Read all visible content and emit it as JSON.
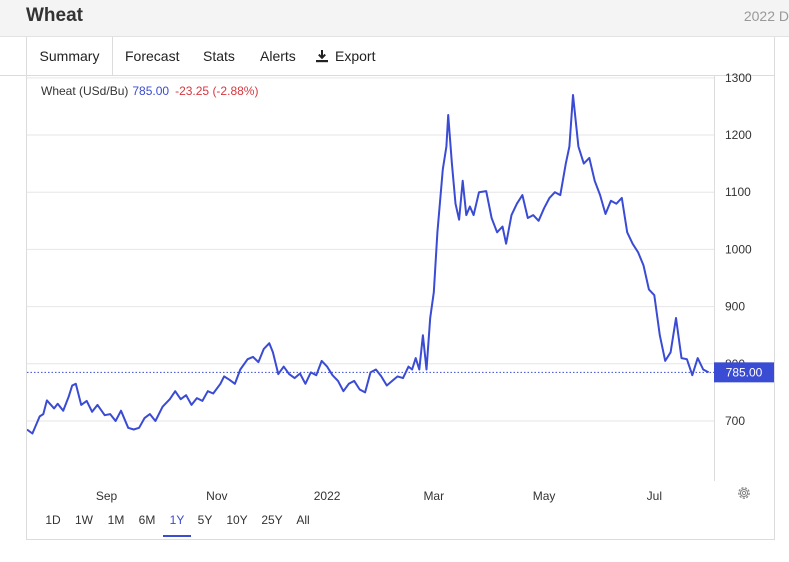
{
  "header": {
    "title": "Wheat",
    "year_label": "2022 D"
  },
  "tabs": [
    {
      "label": "Summary",
      "active": true
    },
    {
      "label": "Forecast"
    },
    {
      "label": "Stats"
    },
    {
      "label": "Alerts"
    },
    {
      "label": "Export",
      "icon": "download-icon"
    }
  ],
  "legend": {
    "instrument": "Wheat (USd/Bu)",
    "price": "785.00",
    "change": "-23.25 (-2.88%)"
  },
  "ranges": [
    {
      "label": "1D"
    },
    {
      "label": "1W"
    },
    {
      "label": "1M"
    },
    {
      "label": "6M"
    },
    {
      "label": "1Y",
      "active": true
    },
    {
      "label": "5Y"
    },
    {
      "label": "10Y"
    },
    {
      "label": "25Y"
    },
    {
      "label": "All"
    }
  ],
  "colors": {
    "line": "#3a4bd4",
    "price_tag": "#3a4bd4",
    "negative": "#d9363e",
    "grid": "#e6e6e6"
  },
  "chart_data": {
    "type": "line",
    "title": "Wheat (USd/Bu)",
    "xlabel": "",
    "ylabel": "",
    "ylim": [
      595,
      1305
    ],
    "y_ticks": [
      700,
      800,
      900,
      1000,
      1100,
      1200,
      1300
    ],
    "y_tick_labels": [
      "700",
      "800",
      "900",
      "1000",
      "1100",
      "1200",
      "1300"
    ],
    "x_ticks": [
      {
        "label": "Sep",
        "date": "2021-09-01"
      },
      {
        "label": "Nov",
        "date": "2021-11-01"
      },
      {
        "label": "2022",
        "date": "2022-01-01"
      },
      {
        "label": "Mar",
        "date": "2022-03-01"
      },
      {
        "label": "May",
        "date": "2022-05-01"
      },
      {
        "label": "Jul",
        "date": "2022-07-01"
      }
    ],
    "last_value": 785.0,
    "last_label": "785.00",
    "grid": true,
    "series": [
      {
        "name": "Wheat (USd/Bu)",
        "points": [
          [
            "2021-07-19",
            685
          ],
          [
            "2021-07-22",
            678
          ],
          [
            "2021-07-26",
            708
          ],
          [
            "2021-07-28",
            712
          ],
          [
            "2021-07-30",
            736
          ],
          [
            "2021-08-03",
            722
          ],
          [
            "2021-08-05",
            730
          ],
          [
            "2021-08-08",
            718
          ],
          [
            "2021-08-11",
            742
          ],
          [
            "2021-08-13",
            762
          ],
          [
            "2021-08-15",
            765
          ],
          [
            "2021-08-18",
            728
          ],
          [
            "2021-08-21",
            735
          ],
          [
            "2021-08-24",
            716
          ],
          [
            "2021-08-27",
            728
          ],
          [
            "2021-08-31",
            710
          ],
          [
            "2021-09-03",
            712
          ],
          [
            "2021-09-06",
            700
          ],
          [
            "2021-09-09",
            718
          ],
          [
            "2021-09-13",
            688
          ],
          [
            "2021-09-16",
            685
          ],
          [
            "2021-09-19",
            688
          ],
          [
            "2021-09-22",
            705
          ],
          [
            "2021-09-25",
            712
          ],
          [
            "2021-09-28",
            700
          ],
          [
            "2021-10-02",
            725
          ],
          [
            "2021-10-06",
            738
          ],
          [
            "2021-10-09",
            752
          ],
          [
            "2021-10-12",
            738
          ],
          [
            "2021-10-15",
            745
          ],
          [
            "2021-10-18",
            728
          ],
          [
            "2021-10-21",
            740
          ],
          [
            "2021-10-24",
            735
          ],
          [
            "2021-10-27",
            752
          ],
          [
            "2021-10-30",
            748
          ],
          [
            "2021-11-03",
            765
          ],
          [
            "2021-11-05",
            778
          ],
          [
            "2021-11-08",
            772
          ],
          [
            "2021-11-11",
            765
          ],
          [
            "2021-11-14",
            790
          ],
          [
            "2021-11-18",
            808
          ],
          [
            "2021-11-21",
            812
          ],
          [
            "2021-11-24",
            803
          ],
          [
            "2021-11-27",
            826
          ],
          [
            "2021-11-30",
            836
          ],
          [
            "2021-12-02",
            820
          ],
          [
            "2021-12-05",
            782
          ],
          [
            "2021-12-08",
            795
          ],
          [
            "2021-12-11",
            782
          ],
          [
            "2021-12-14",
            775
          ],
          [
            "2021-12-17",
            783
          ],
          [
            "2021-12-20",
            765
          ],
          [
            "2021-12-23",
            785
          ],
          [
            "2021-12-26",
            780
          ],
          [
            "2021-12-29",
            805
          ],
          [
            "2022-01-01",
            795
          ],
          [
            "2022-01-04",
            780
          ],
          [
            "2022-01-07",
            770
          ],
          [
            "2022-01-10",
            752
          ],
          [
            "2022-01-13",
            765
          ],
          [
            "2022-01-16",
            770
          ],
          [
            "2022-01-19",
            755
          ],
          [
            "2022-01-22",
            750
          ],
          [
            "2022-01-25",
            785
          ],
          [
            "2022-01-28",
            790
          ],
          [
            "2022-01-31",
            778
          ],
          [
            "2022-02-03",
            762
          ],
          [
            "2022-02-06",
            770
          ],
          [
            "2022-02-09",
            778
          ],
          [
            "2022-02-12",
            775
          ],
          [
            "2022-02-15",
            795
          ],
          [
            "2022-02-17",
            790
          ],
          [
            "2022-02-19",
            810
          ],
          [
            "2022-02-21",
            790
          ],
          [
            "2022-02-23",
            850
          ],
          [
            "2022-02-25",
            790
          ],
          [
            "2022-02-27",
            880
          ],
          [
            "2022-03-01",
            925
          ],
          [
            "2022-03-03",
            1030
          ],
          [
            "2022-03-06",
            1140
          ],
          [
            "2022-03-08",
            1180
          ],
          [
            "2022-03-09",
            1235
          ],
          [
            "2022-03-11",
            1150
          ],
          [
            "2022-03-13",
            1080
          ],
          [
            "2022-03-15",
            1052
          ],
          [
            "2022-03-17",
            1120
          ],
          [
            "2022-03-19",
            1060
          ],
          [
            "2022-03-21",
            1075
          ],
          [
            "2022-03-23",
            1060
          ],
          [
            "2022-03-26",
            1100
          ],
          [
            "2022-03-30",
            1102
          ],
          [
            "2022-04-02",
            1055
          ],
          [
            "2022-04-05",
            1030
          ],
          [
            "2022-04-08",
            1040
          ],
          [
            "2022-04-10",
            1010
          ],
          [
            "2022-04-13",
            1060
          ],
          [
            "2022-04-16",
            1080
          ],
          [
            "2022-04-19",
            1095
          ],
          [
            "2022-04-22",
            1055
          ],
          [
            "2022-04-25",
            1060
          ],
          [
            "2022-04-28",
            1050
          ],
          [
            "2022-05-01",
            1072
          ],
          [
            "2022-05-04",
            1090
          ],
          [
            "2022-05-07",
            1100
          ],
          [
            "2022-05-10",
            1095
          ],
          [
            "2022-05-13",
            1150
          ],
          [
            "2022-05-15",
            1180
          ],
          [
            "2022-05-17",
            1270
          ],
          [
            "2022-05-20",
            1180
          ],
          [
            "2022-05-23",
            1150
          ],
          [
            "2022-05-26",
            1160
          ],
          [
            "2022-05-29",
            1120
          ],
          [
            "2022-06-01",
            1095
          ],
          [
            "2022-06-04",
            1062
          ],
          [
            "2022-06-07",
            1085
          ],
          [
            "2022-06-10",
            1080
          ],
          [
            "2022-06-13",
            1090
          ],
          [
            "2022-06-16",
            1030
          ],
          [
            "2022-06-19",
            1010
          ],
          [
            "2022-06-22",
            995
          ],
          [
            "2022-06-25",
            972
          ],
          [
            "2022-06-28",
            930
          ],
          [
            "2022-07-01",
            920
          ],
          [
            "2022-07-04",
            850
          ],
          [
            "2022-07-07",
            805
          ],
          [
            "2022-07-10",
            820
          ],
          [
            "2022-07-13",
            880
          ],
          [
            "2022-07-16",
            810
          ],
          [
            "2022-07-19",
            808
          ],
          [
            "2022-07-22",
            780
          ],
          [
            "2022-07-25",
            810
          ],
          [
            "2022-07-28",
            790
          ],
          [
            "2022-07-31",
            785
          ]
        ]
      }
    ]
  }
}
